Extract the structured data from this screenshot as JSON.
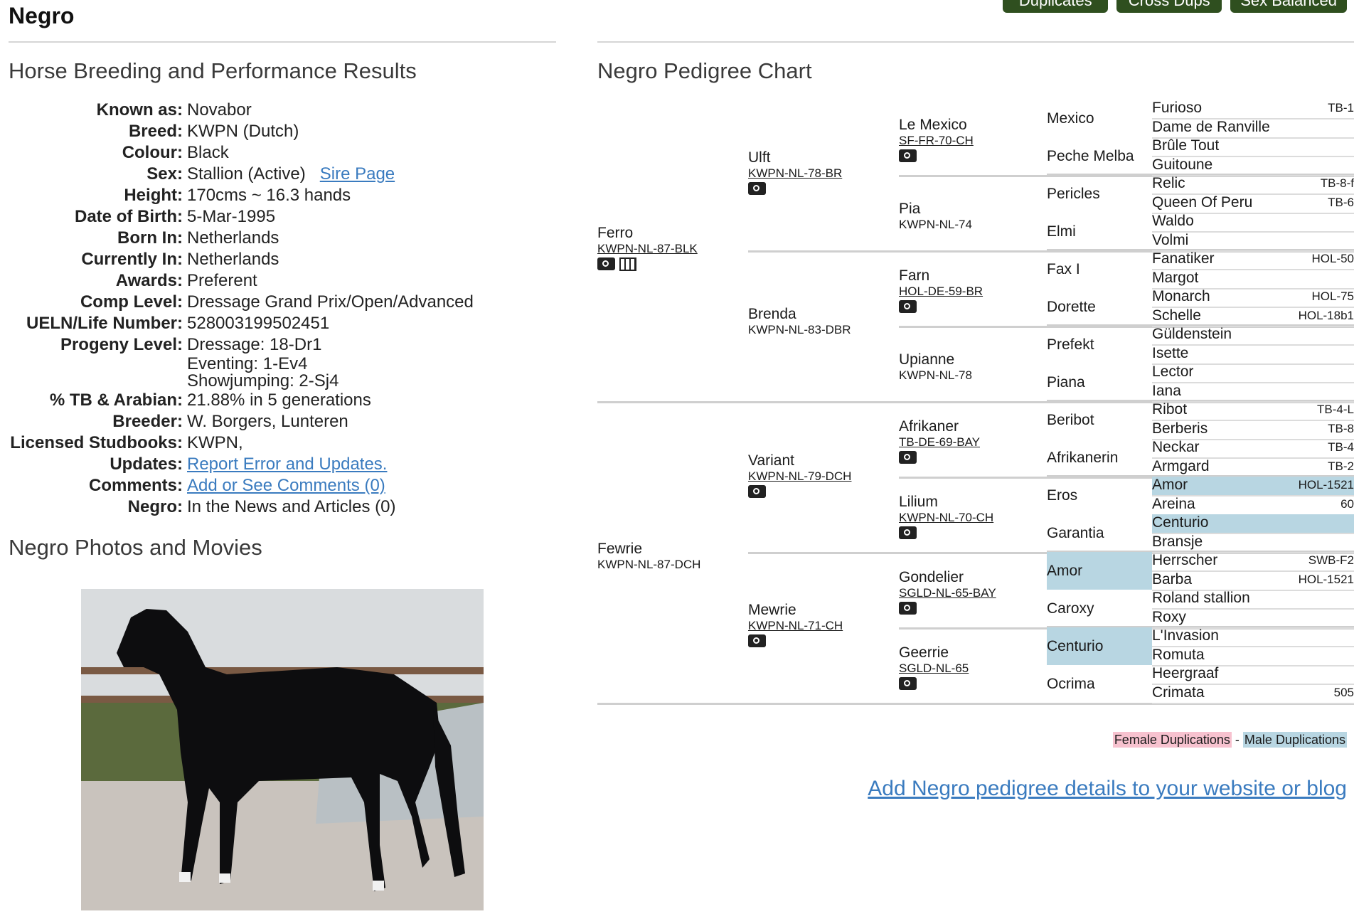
{
  "header": {
    "horse_name": "Negro",
    "buttons": [
      "Duplicates",
      "Cross Dups",
      "Sex Balanced"
    ]
  },
  "details_section": {
    "title": "Horse Breeding and Performance Results",
    "rows": [
      {
        "label": "Known as:",
        "value": "Novabor"
      },
      {
        "label": "Breed:",
        "value": "KWPN (Dutch)"
      },
      {
        "label": "Colour:",
        "value": "Black"
      },
      {
        "label": "Sex:",
        "value": "Stallion (Active)",
        "link": "Sire Page"
      },
      {
        "label": "Height:",
        "value": "170cms ~ 16.3 hands"
      },
      {
        "label": "Date of Birth:",
        "value": "5-Mar-1995"
      },
      {
        "label": "Born In:",
        "value": "Netherlands"
      },
      {
        "label": "Currently In:",
        "value": "Netherlands"
      },
      {
        "label": "Awards:",
        "value": "Preferent"
      },
      {
        "label": "Comp Level:",
        "value": "Dressage Grand Prix/Open/Advanced"
      },
      {
        "label": "UELN/Life Number:",
        "value": "528003199502451"
      },
      {
        "label": "Progeny Level:",
        "lines": [
          "Dressage: 18-Dr1",
          "Eventing: 1-Ev4",
          "Showjumping: 2-Sj4"
        ]
      },
      {
        "label": "% TB & Arabian:",
        "value": "21.88% in 5 generations"
      },
      {
        "label": "Breeder:",
        "value": "W. Borgers, Lunteren"
      },
      {
        "label": "Licensed Studbooks:",
        "value": "KWPN,"
      },
      {
        "label": "Updates:",
        "link": "Report Error and Updates."
      },
      {
        "label": "Comments:",
        "link": "Add or See Comments (0)"
      },
      {
        "label": "Negro:",
        "value": "In the News and Articles (0)"
      }
    ]
  },
  "photos_section": {
    "title": "Negro Photos and Movies"
  },
  "pedigree": {
    "title": "Negro Pedigree Chart",
    "gen1": [
      {
        "name": "Ferro",
        "reg": "KWPN-NL-87-BLK"
      },
      {
        "name": "Fewrie",
        "reg": "KWPN-NL-87-DCH"
      }
    ],
    "gen2": [
      {
        "name": "Ulft",
        "reg": "KWPN-NL-78-BR"
      },
      {
        "name": "Brenda",
        "reg": "KWPN-NL-83-DBR"
      },
      {
        "name": "Variant",
        "reg": "KWPN-NL-79-DCH"
      },
      {
        "name": "Mewrie",
        "reg": "KWPN-NL-71-CH"
      }
    ],
    "gen3": [
      {
        "name": "Le Mexico",
        "reg": "SF-FR-70-CH"
      },
      {
        "name": "Pia",
        "reg": "KWPN-NL-74"
      },
      {
        "name": "Farn",
        "reg": "HOL-DE-59-BR"
      },
      {
        "name": "Upianne",
        "reg": "KWPN-NL-78"
      },
      {
        "name": "Afrikaner",
        "reg": "TB-DE-69-BAY"
      },
      {
        "name": "Lilium",
        "reg": "KWPN-NL-70-CH"
      },
      {
        "name": "Gondelier",
        "reg": "SGLD-NL-65-BAY"
      },
      {
        "name": "Geerrie",
        "reg": "SGLD-NL-65"
      }
    ],
    "gen4": [
      "Mexico",
      "Peche Melba",
      "Pericles",
      "Elmi",
      "Fax I",
      "Dorette",
      "Prefekt",
      "Piana",
      "Beribot",
      "Afrikanerin",
      "Eros",
      "Garantia",
      "Amor",
      "Caroxy",
      "Centurio",
      "Ocrima"
    ],
    "gen5": [
      {
        "name": "Furioso",
        "code": "TB-1"
      },
      {
        "name": "Dame de Ranville",
        "code": ""
      },
      {
        "name": "Brûle Tout",
        "code": ""
      },
      {
        "name": "Guitoune",
        "code": ""
      },
      {
        "name": "Relic",
        "code": "TB-8-f"
      },
      {
        "name": "Queen Of Peru",
        "code": "TB-6"
      },
      {
        "name": "Waldo",
        "code": ""
      },
      {
        "name": "Volmi",
        "code": ""
      },
      {
        "name": "Fanatiker",
        "code": "HOL-50"
      },
      {
        "name": "Margot",
        "code": ""
      },
      {
        "name": "Monarch",
        "code": "HOL-75"
      },
      {
        "name": "Schelle",
        "code": "HOL-18b1"
      },
      {
        "name": "Güldenstein",
        "code": ""
      },
      {
        "name": "Isette",
        "code": ""
      },
      {
        "name": "Lector",
        "code": ""
      },
      {
        "name": "Iana",
        "code": ""
      },
      {
        "name": "Ribot",
        "code": "TB-4-L"
      },
      {
        "name": "Berberis",
        "code": "TB-8"
      },
      {
        "name": "Neckar",
        "code": "TB-4"
      },
      {
        "name": "Armgard",
        "code": "TB-2"
      },
      {
        "name": "Amor",
        "code": "HOL-1521"
      },
      {
        "name": "Areina",
        "code": "60"
      },
      {
        "name": "Centurio",
        "code": ""
      },
      {
        "name": "Bransje",
        "code": ""
      },
      {
        "name": "Herrscher",
        "code": "SWB-F2"
      },
      {
        "name": "Barba",
        "code": "HOL-1521"
      },
      {
        "name": "Roland stallion",
        "code": ""
      },
      {
        "name": "Roxy",
        "code": ""
      },
      {
        "name": "L'Invasion",
        "code": ""
      },
      {
        "name": "Romuta",
        "code": ""
      },
      {
        "name": "Heergraaf",
        "code": ""
      },
      {
        "name": "Crimata",
        "code": "505"
      }
    ],
    "legend": {
      "female": "Female Duplications",
      "separator": "-",
      "male": "Male Duplications"
    },
    "add_link": "Add Negro pedigree details to your website or blog",
    "colors": {
      "male_dup": "#b8d6e2",
      "female_dup": "#f7c2cf",
      "button": "#2f4f1f",
      "link": "#3a7bbf"
    }
  }
}
